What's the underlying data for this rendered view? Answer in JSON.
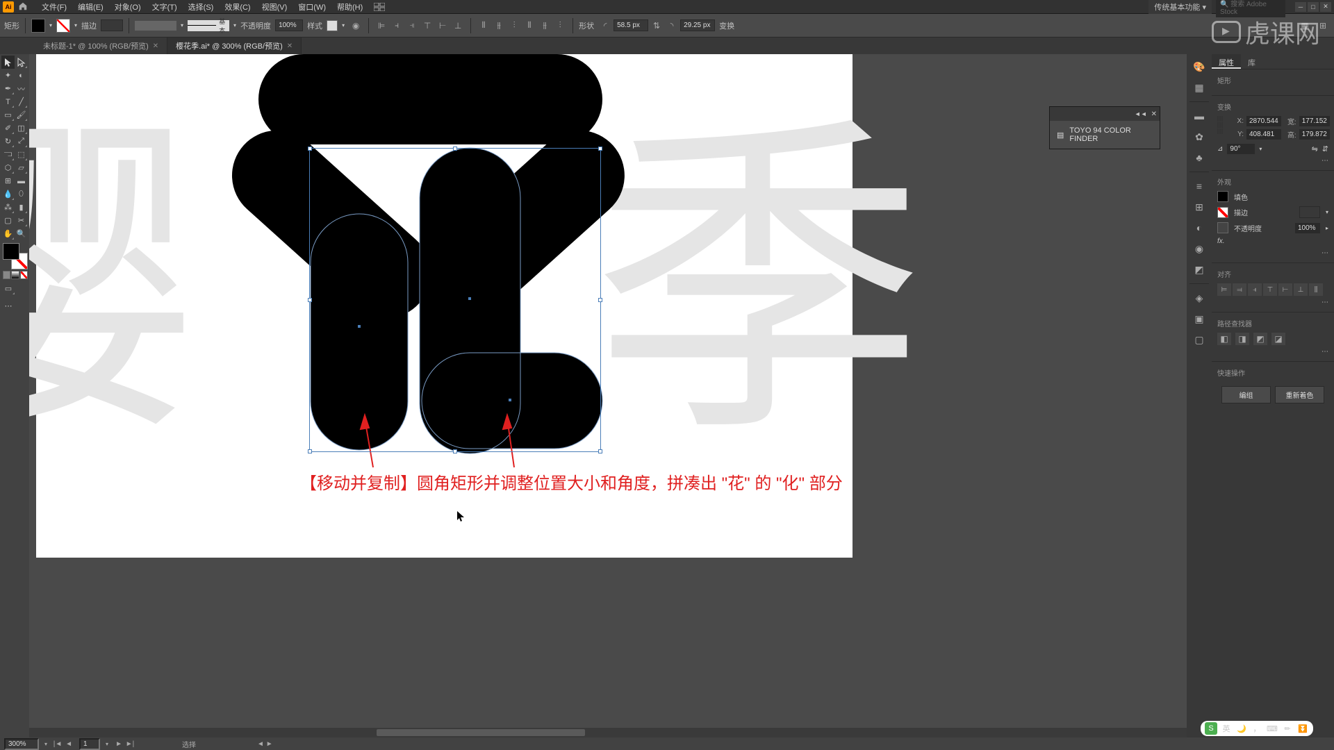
{
  "app": {
    "name": "Ai"
  },
  "menu": [
    "文件(F)",
    "编辑(E)",
    "对象(O)",
    "文字(T)",
    "选择(S)",
    "效果(C)",
    "视图(V)",
    "窗口(W)",
    "帮助(H)"
  ],
  "workspace": "传统基本功能",
  "stock": "搜索 Adobe Stock",
  "control": {
    "shape": "矩形",
    "stroke_label": "描边",
    "stroke_weight": "",
    "stroke_style": "基本",
    "opacity_label": "不透明度",
    "opacity": "100%",
    "style_label": "样式",
    "shape_label": "形状",
    "corner_radius": "58.5 px",
    "corner_radius2": "29.25 px",
    "transform_label": "变换"
  },
  "tabs": [
    {
      "label": "未标题-1* @ 100% (RGB/预览)",
      "active": false
    },
    {
      "label": "樱花季.ai* @ 300% (RGB/预览)",
      "active": true
    }
  ],
  "float_panel": {
    "title": "TOYO 94 COLOR FINDER"
  },
  "annotation": "【移动并复制】圆角矩形并调整位置大小和角度，拼凑出 \"花\" 的 \"化\" 部分",
  "props": {
    "tab1": "属性",
    "tab2": "库",
    "shape_type": "矩形",
    "transform_title": "变换",
    "x": "2870.544",
    "w": "177.152",
    "y": "408.481",
    "h": "179.872",
    "angle": "90°",
    "appearance_title": "外观",
    "fill_label": "填色",
    "stroke_label": "描边",
    "stroke_val": "",
    "opacity_label": "不透明度",
    "opacity_val": "100%",
    "fx_label": "fx.",
    "align_title": "对齐",
    "pathfinder_title": "路径查找器",
    "quick_title": "快速操作",
    "btn_edit": "编组",
    "btn_recolor": "重新着色"
  },
  "status": {
    "zoom": "300%",
    "artboard": "1",
    "tool": "选择"
  },
  "watermark": "虎课网",
  "ime": "英"
}
